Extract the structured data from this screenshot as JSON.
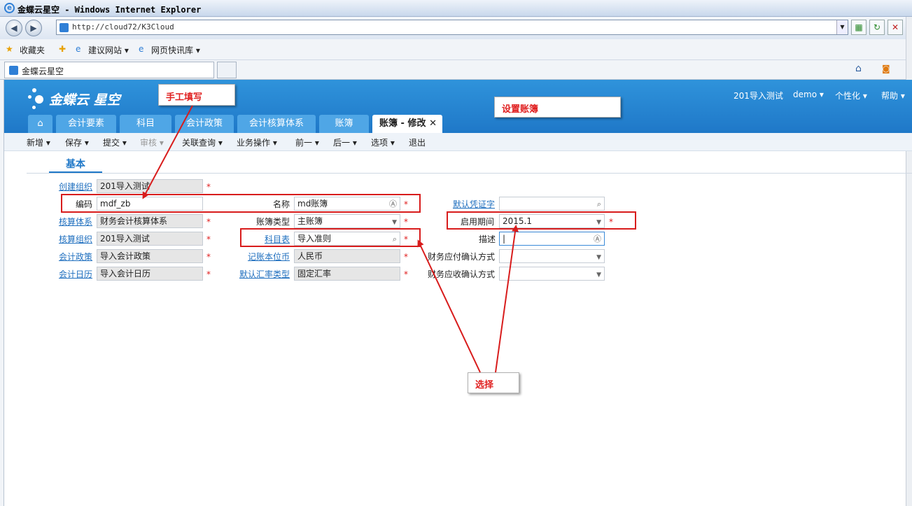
{
  "browser": {
    "window_title": "金蝶云星空 - Windows Internet Explorer",
    "url": "http://cloud72/K3Cloud",
    "favorites_label": "收藏夹",
    "fav_links": [
      "建议网站 ▾",
      "网页快讯库 ▾"
    ],
    "tab_title": "金蝶云星空"
  },
  "app": {
    "logo_text": "金蝶云 星空",
    "top_menu": [
      "201导入测试",
      "demo ▾",
      "个性化 ▾",
      "帮助 ▾"
    ],
    "tabs": [
      "会计要素",
      "科目",
      "会计政策",
      "会计核算体系",
      "账簿",
      "账簿 - 修改"
    ],
    "close_glyph": "✕",
    "toolbar": [
      "新增 ▾",
      "保存 ▾",
      "提交 ▾",
      "审核 ▾",
      "关联查询 ▾",
      "业务操作 ▾",
      "前一 ▾",
      "后一 ▾",
      "选项 ▾",
      "退出"
    ],
    "section_tab": "基本"
  },
  "form": {
    "labels": {
      "create_org": "创建组织",
      "code": "编码",
      "name": "名称",
      "default_voucher": "默认凭证字",
      "accounting_system": "核算体系",
      "book_type": "账簿类型",
      "start_period": "启用期间",
      "accounting_org": "核算组织",
      "account_table": "科目表",
      "description": "描述",
      "accounting_policy": "会计政策",
      "base_currency": "记账本位币",
      "payable_confirm": "财务应付确认方式",
      "calendar": "会计日历",
      "rate_type": "默认汇率类型",
      "receivable_confirm": "财务应收确认方式"
    },
    "values": {
      "create_org": "201导入测试",
      "code": "mdf_zb",
      "name": "md账簿",
      "default_voucher": "",
      "accounting_system": "财务会计核算体系",
      "book_type": "主账簿",
      "start_period": "2015.1",
      "accounting_org": "201导入测试",
      "account_table": "导入准则",
      "description": "|",
      "accounting_policy": "导入会计政策",
      "base_currency": "人民币",
      "payable_confirm": "",
      "calendar": "导入会计日历",
      "rate_type": "固定汇率",
      "receivable_confirm": ""
    },
    "required_mark": "*"
  },
  "annotations": {
    "manual_fill": "手工填写",
    "set_ledger": "设置账簿",
    "select": "选择"
  }
}
